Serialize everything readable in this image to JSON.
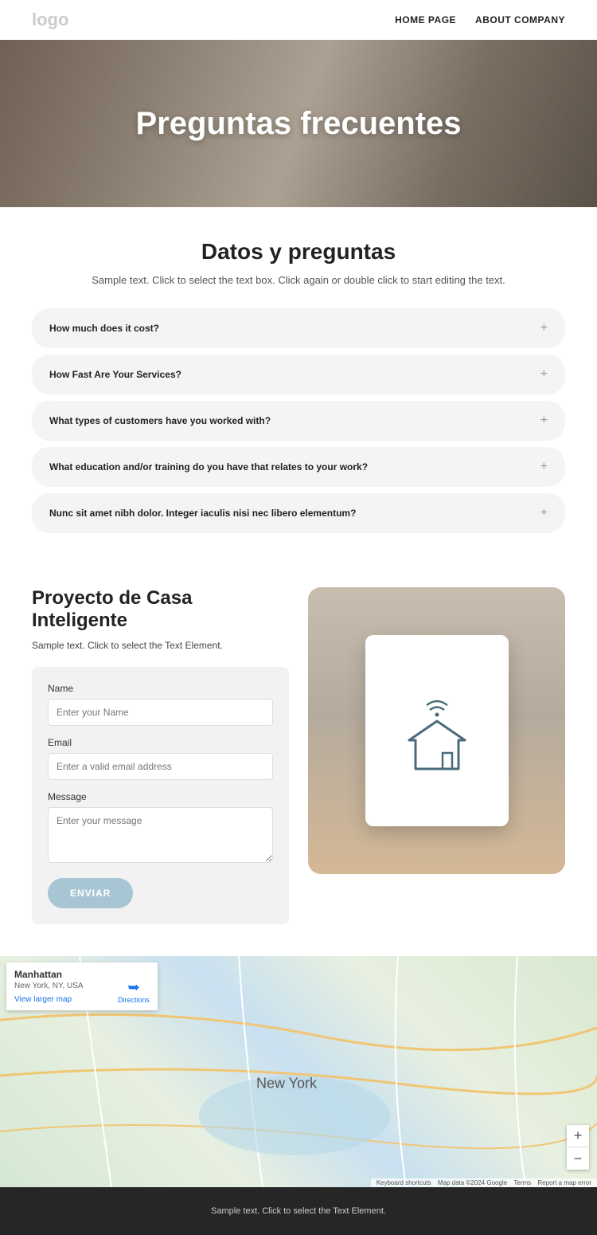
{
  "header": {
    "logo": "logo",
    "nav": {
      "home": "HOME PAGE",
      "about": "ABOUT COMPANY"
    }
  },
  "hero": {
    "title": "Preguntas frecuentes"
  },
  "faq": {
    "title": "Datos y preguntas",
    "subtitle": "Sample text. Click to select the text box. Click again or double click to start editing the text.",
    "items": [
      {
        "q": "How much does it cost?"
      },
      {
        "q": "How Fast Are Your Services?"
      },
      {
        "q": "What types of customers have you worked with?"
      },
      {
        "q": "What education and/or training do you have that relates to your work?"
      },
      {
        "q": "Nunc sit amet nibh dolor. Integer iaculis nisi nec libero elementum?"
      }
    ]
  },
  "contact": {
    "title": "Proyecto de Casa Inteligente",
    "subtitle": "Sample text. Click to select the Text Element.",
    "form": {
      "name_label": "Name",
      "name_placeholder": "Enter your Name",
      "email_label": "Email",
      "email_placeholder": "Enter a valid email address",
      "message_label": "Message",
      "message_placeholder": "Enter your message",
      "submit": "ENVIAR"
    }
  },
  "map": {
    "info_title": "Manhattan",
    "info_addr": "New York, NY, USA",
    "view_larger": "View larger map",
    "directions": "Directions",
    "city_label": "New York",
    "attribution": {
      "shortcuts": "Keyboard shortcuts",
      "data": "Map data ©2024 Google",
      "terms": "Terms",
      "report": "Report a map error"
    }
  },
  "footer": {
    "text": "Sample text. Click to select the Text Element."
  }
}
